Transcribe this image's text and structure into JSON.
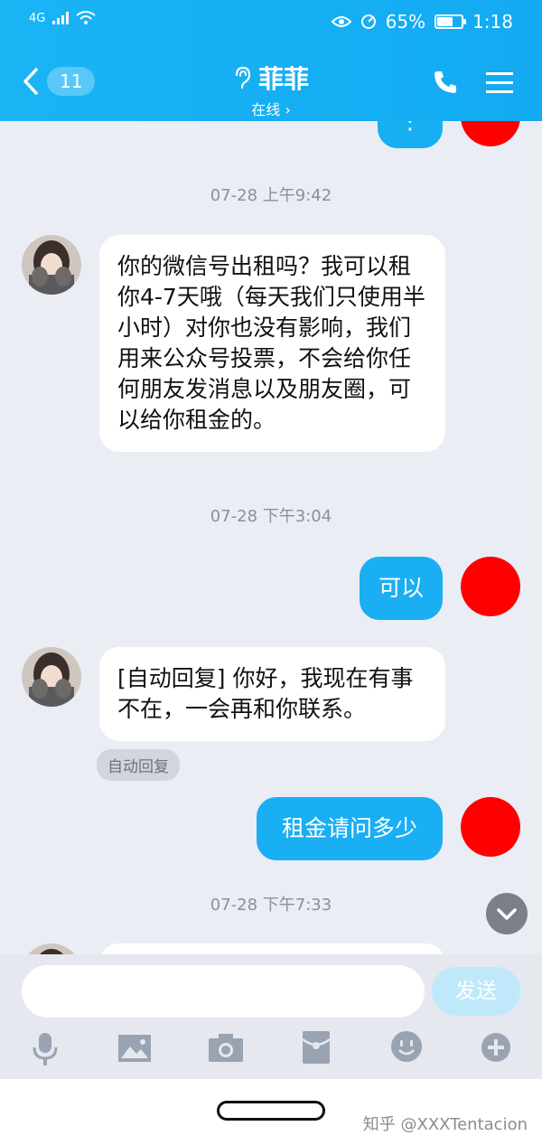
{
  "status_bar": {
    "network": "4G",
    "battery_percent": "65%",
    "battery_level": 0.65,
    "time": "1:18"
  },
  "header": {
    "back_count": "11",
    "contact_name": "菲菲",
    "contact_status": "在线 ›"
  },
  "messages": {
    "ts1": "07-28 上午9:42",
    "msg1": "你的微信号出租吗？我可以租你4-7天哦（每天我们只使用半小时）对你也没有影响，我们用来公众号投票，不会给你任何朋友发消息以及朋友圈，可以给你租金的。",
    "ts2": "07-28 下午3:04",
    "msg2": "可以",
    "msg3": "[自动回复] 你好，我现在有事不在，一会再和你联系。",
    "tag": "自动回复",
    "msg4": "租金请问多少",
    "ts3": "07-28 下午7:33",
    "top_partial": "⋮"
  },
  "input": {
    "placeholder": "",
    "send_label": "发送"
  },
  "toolbar": [
    "mic-icon",
    "image-icon",
    "camera-icon",
    "red-packet-icon",
    "emoji-icon",
    "plus-icon"
  ],
  "watermark": "知乎 @XXXTentacion",
  "colors": {
    "header": "#16aff4",
    "bubble_out": "#1aaef3",
    "red_avatar": "#ff0000"
  }
}
